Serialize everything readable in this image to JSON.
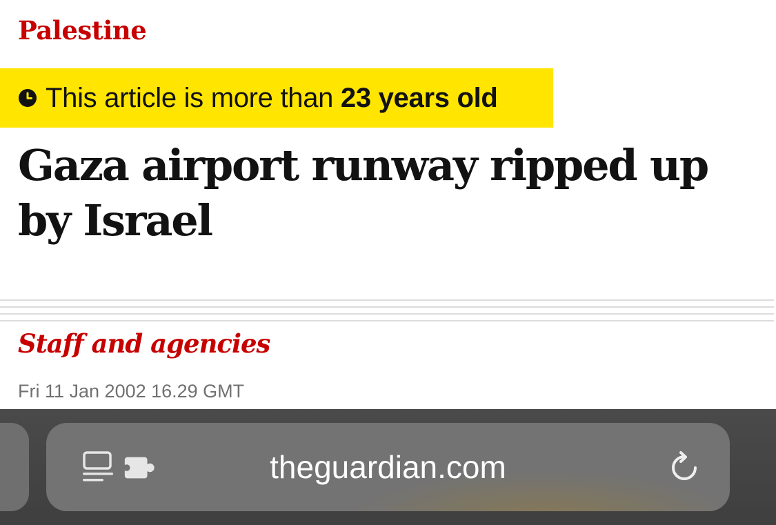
{
  "article": {
    "section": "Palestine",
    "age_banner": {
      "prefix": "This article is more than ",
      "age": "23 years old",
      "icon": "clock-icon"
    },
    "headline": "Gaza airport runway ripped up by Israel",
    "byline": "Staff and agencies",
    "dateline": "Fri 11 Jan 2002 16.29 GMT"
  },
  "browser": {
    "url": "theguardian.com",
    "left_icons": [
      "reader-mode-icon",
      "extension-puzzle-icon"
    ],
    "right_icon": "reload-icon"
  },
  "colors": {
    "accent_red": "#c70000",
    "banner_yellow": "#ffe500",
    "text_dark": "#121212",
    "meta_gray": "#707070"
  }
}
